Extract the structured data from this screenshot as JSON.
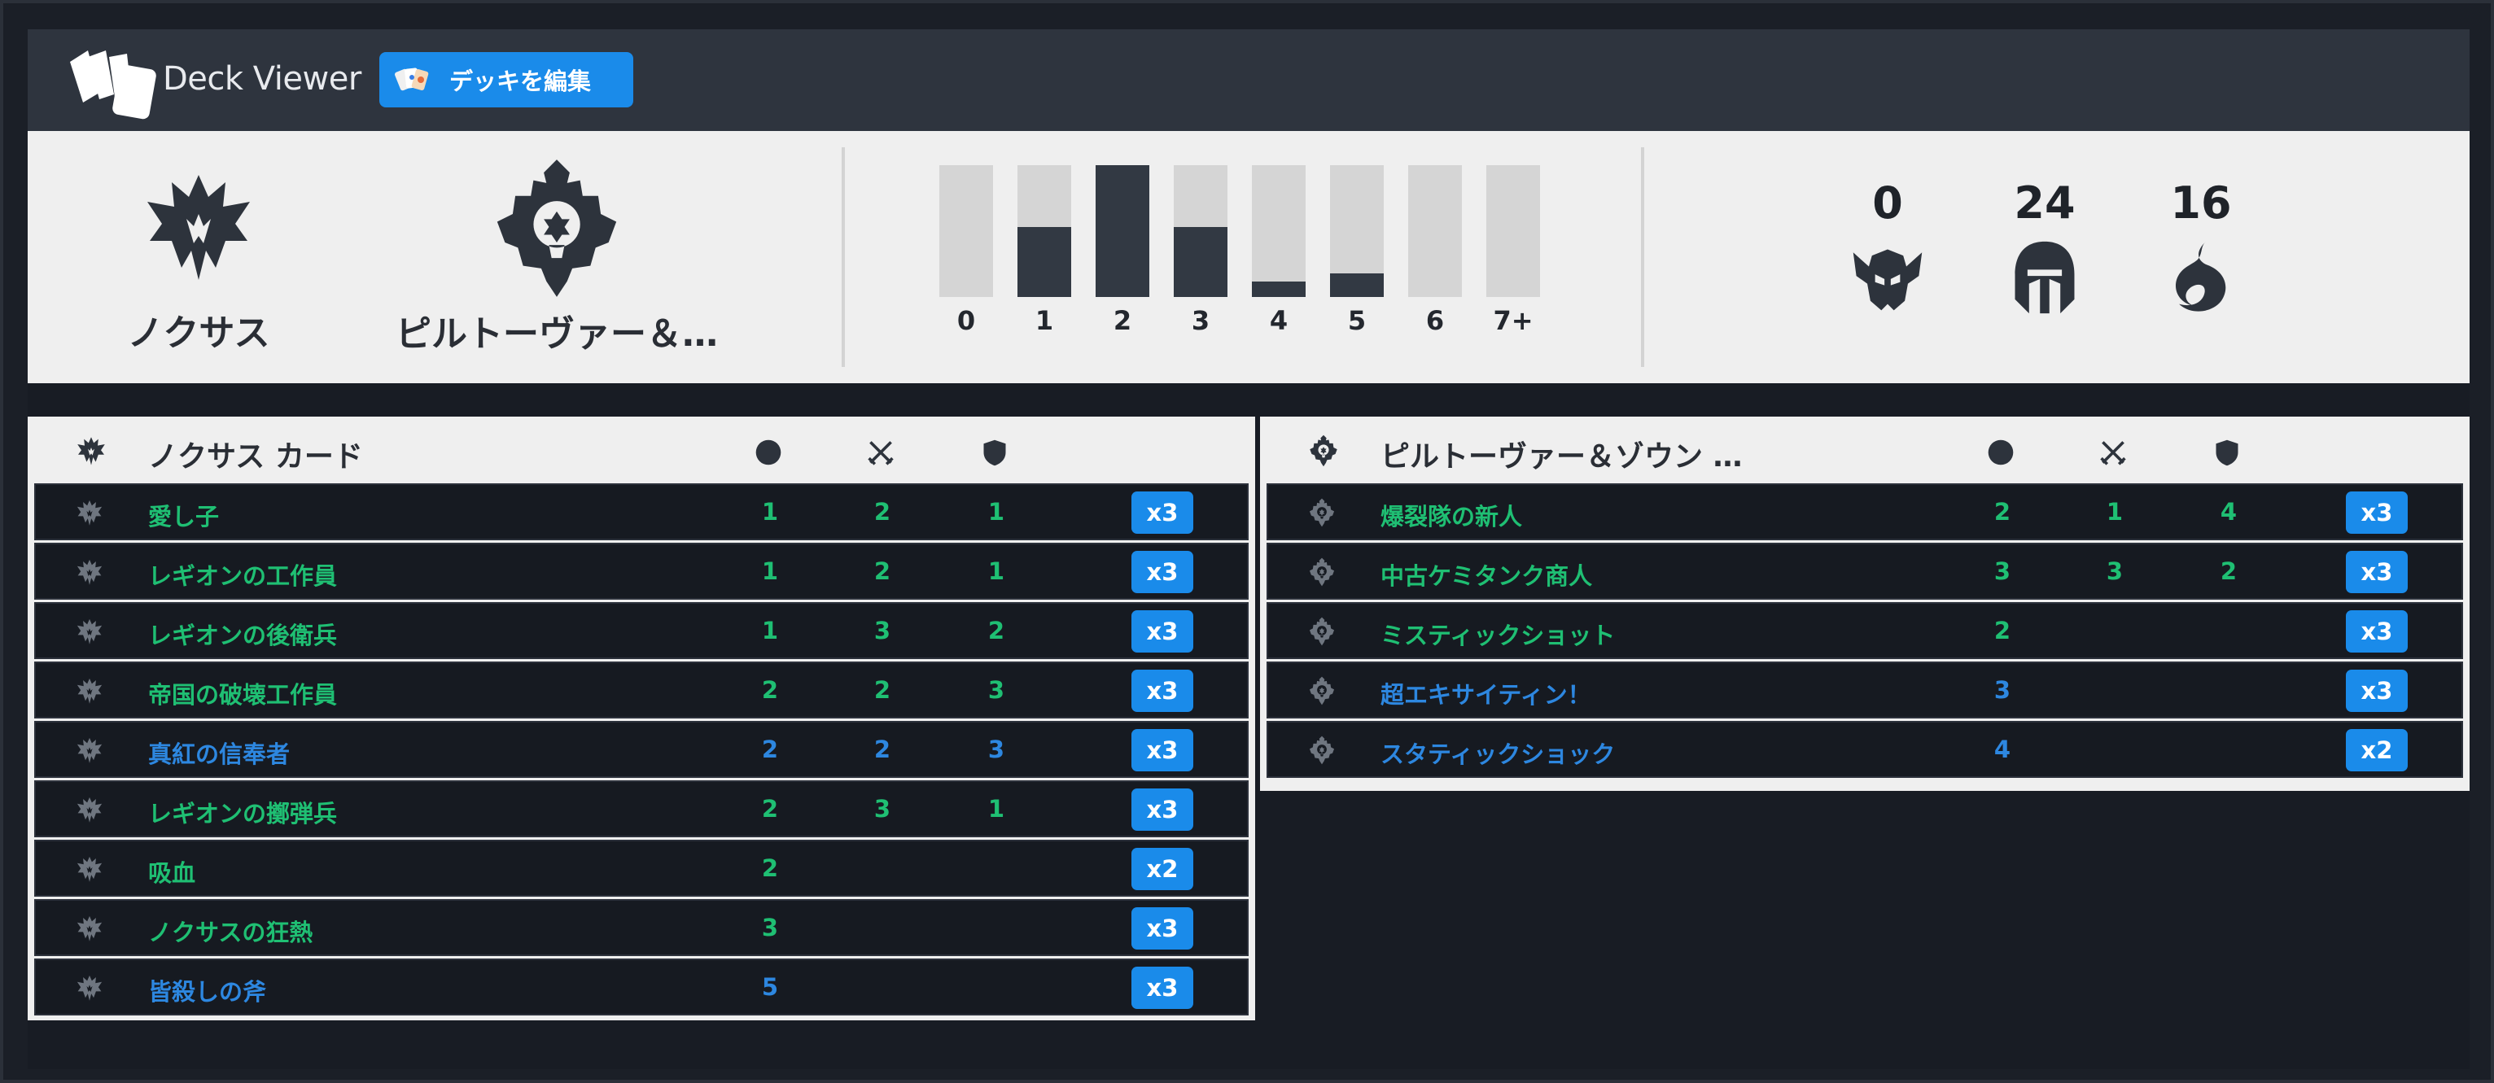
{
  "app": {
    "title": "Deck Viewer"
  },
  "toolbar": {
    "edit_label": "デッキを編集"
  },
  "colors": {
    "accent": "#1a8bea",
    "common": "#1fbf73",
    "rare": "#2d87e0",
    "header_bg": "#2e343e",
    "page_bg": "#181c24",
    "summary_bg": "#efefef"
  },
  "regions": [
    {
      "name": "ノクサス",
      "icon": "noxus-icon"
    },
    {
      "name": "ピルトーヴァー＆…",
      "icon": "piltover-zaun-icon"
    }
  ],
  "mana_curve": {
    "labels": [
      "0",
      "1",
      "2",
      "3",
      "4",
      "5",
      "6",
      "7+"
    ],
    "fill": [
      0,
      0.53,
      1.0,
      0.53,
      0.12,
      0.18,
      0,
      0
    ]
  },
  "type_counts": [
    {
      "type": "champion",
      "icon": "champion-icon",
      "count": "0"
    },
    {
      "type": "follower",
      "icon": "follower-icon",
      "count": "24"
    },
    {
      "type": "spell",
      "icon": "spell-icon",
      "count": "16"
    }
  ],
  "tables": [
    {
      "title": "ノクサス カード",
      "icon": "noxus-icon",
      "column_icons": [
        "mana-cost-icon",
        "attack-icon",
        "health-icon"
      ],
      "rows": [
        {
          "name": "愛し子",
          "cost": "1",
          "attack": "2",
          "health": "1",
          "qty": "x3",
          "rarity": "common"
        },
        {
          "name": "レギオンの工作員",
          "cost": "1",
          "attack": "2",
          "health": "1",
          "qty": "x3",
          "rarity": "common"
        },
        {
          "name": "レギオンの後衛兵",
          "cost": "1",
          "attack": "3",
          "health": "2",
          "qty": "x3",
          "rarity": "common"
        },
        {
          "name": "帝国の破壊工作員",
          "cost": "2",
          "attack": "2",
          "health": "3",
          "qty": "x3",
          "rarity": "common"
        },
        {
          "name": "真紅の信奉者",
          "cost": "2",
          "attack": "2",
          "health": "3",
          "qty": "x3",
          "rarity": "rare"
        },
        {
          "name": "レギオンの擲弾兵",
          "cost": "2",
          "attack": "3",
          "health": "1",
          "qty": "x3",
          "rarity": "common"
        },
        {
          "name": "吸血",
          "cost": "2",
          "attack": "",
          "health": "",
          "qty": "x2",
          "rarity": "common"
        },
        {
          "name": "ノクサスの狂熱",
          "cost": "3",
          "attack": "",
          "health": "",
          "qty": "x3",
          "rarity": "common"
        },
        {
          "name": "皆殺しの斧",
          "cost": "5",
          "attack": "",
          "health": "",
          "qty": "x3",
          "rarity": "rare"
        }
      ]
    },
    {
      "title": "ピルトーヴァー＆ゾウン …",
      "icon": "piltover-zaun-icon",
      "column_icons": [
        "mana-cost-icon",
        "attack-icon",
        "health-icon"
      ],
      "rows": [
        {
          "name": "爆裂隊の新人",
          "cost": "2",
          "attack": "1",
          "health": "4",
          "qty": "x3",
          "rarity": "common"
        },
        {
          "name": "中古ケミタンク商人",
          "cost": "3",
          "attack": "3",
          "health": "2",
          "qty": "x3",
          "rarity": "common"
        },
        {
          "name": "ミスティックショット",
          "cost": "2",
          "attack": "",
          "health": "",
          "qty": "x3",
          "rarity": "common"
        },
        {
          "name": "超エキサイティン！",
          "cost": "3",
          "attack": "",
          "health": "",
          "qty": "x3",
          "rarity": "rare"
        },
        {
          "name": "スタティックショック",
          "cost": "4",
          "attack": "",
          "health": "",
          "qty": "x2",
          "rarity": "rare"
        }
      ]
    }
  ]
}
